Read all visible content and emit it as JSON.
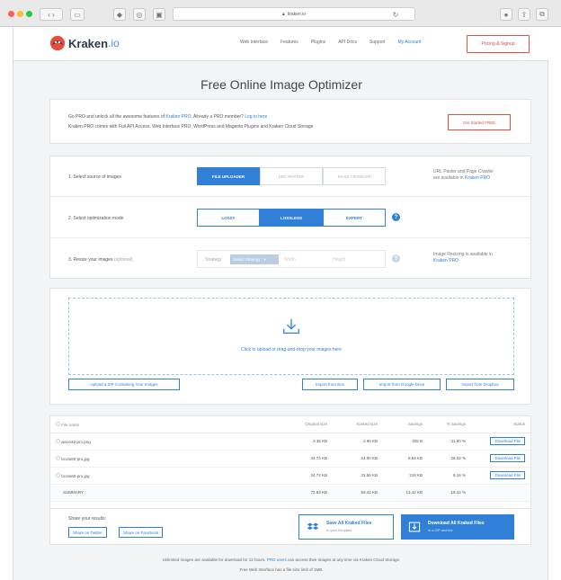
{
  "browser": {
    "url": "kraken.io"
  },
  "nav": {
    "brand": "Kraken",
    "brand_suffix": ".io",
    "links": [
      "Web Interface",
      "Features",
      "Plugins",
      "API Docs",
      "Support"
    ],
    "my_account": "My Account",
    "pricing": "Pricing & Signup"
  },
  "title": "Free Online Image Optimizer",
  "promo": {
    "line1_prefix": "Go PRO and unlock all the awesome features of ",
    "line1_link": "Kraken PRO",
    "line1_mid": ". Already a PRO member? ",
    "line1_login": "Log in here",
    "line2": "Kraken PRO comes with Full API Access, Web Interface PRO, WordPress and Magento Plugins and Kraken Cloud Storage",
    "cta": "Get Started FREE"
  },
  "steps": {
    "source_label": "1. Select source of images",
    "source_options": [
      "FILE UPLOADER",
      "URL PASTER",
      "PAGE CRAWLER"
    ],
    "source_note_prefix": "URL Paster and Page Crawler",
    "source_note_suffix": "are available in ",
    "source_note_link": "Kraken PRO",
    "mode_label": "2. Select optimization mode",
    "mode_options": [
      "LOSSY",
      "LOSSLESS",
      "EXPERT"
    ],
    "resize_label": "3. Resize your images",
    "resize_optional": "(optional)",
    "resize_strategy": "Strategy",
    "resize_select": "Select Strategy",
    "resize_width": "Width",
    "resize_height": "Height",
    "resize_note": "Image Resizing is available in ",
    "resize_note_link": "Kraken PRO"
  },
  "upload": {
    "drop_text": "Click to upload or drag-and-drop your images here",
    "zip_button": "Upload a ZIP Containing Your Images",
    "import_box": "Import from Box",
    "import_drive": "Import from Google Drive",
    "import_dropbox": "Import from Dropbox"
  },
  "table": {
    "headers": [
      "File name",
      "Original size",
      "Kraked size",
      "Savings",
      "% Savings",
      "Status"
    ],
    "rows": [
      {
        "name": "avion32-pro.png",
        "orig": "3.35 KB",
        "kraked": "2.96 KB",
        "savings": "405 B",
        "pct": "11.80 %",
        "status": "Download File"
      },
      {
        "name": "bcotu60-pro.jpg",
        "orig": "34.74 KB",
        "kraked": "24.90 KB",
        "savings": "9.84 KB",
        "pct": "28.32 %",
        "status": "Download File"
      },
      {
        "name": "bcotu60-pro.jpg",
        "orig": "34.74 KB",
        "kraked": "31.56 KB",
        "savings": "318 KB",
        "pct": "9.16 %",
        "status": "Download File"
      }
    ],
    "summary": {
      "name": "SUMMARY",
      "orig": "72.83 KB",
      "kraked": "59.41 KB",
      "savings": "13.42 KB",
      "pct": "18.42 %"
    }
  },
  "share": {
    "label": "Share your results:",
    "twitter": "Share on Twitter",
    "facebook": "Share on Facebook"
  },
  "save": {
    "dropbox_title": "Save All Kraked Files",
    "dropbox_sub": "in your Dropbox",
    "zip_title": "Download All Kraked Files",
    "zip_sub": "in a ZIP archive"
  },
  "footer": {
    "line1_prefix": "Unlimited images are available for download for 12 hours. ",
    "line1_link": "PRO users",
    "line1_suffix": " can access their images at any time via Kraken Cloud Storage.",
    "line2": "Free Web Interface has a file size limit of 1MB."
  },
  "colors": {
    "accent": "#2f80d6",
    "danger": "#e74c3c"
  }
}
